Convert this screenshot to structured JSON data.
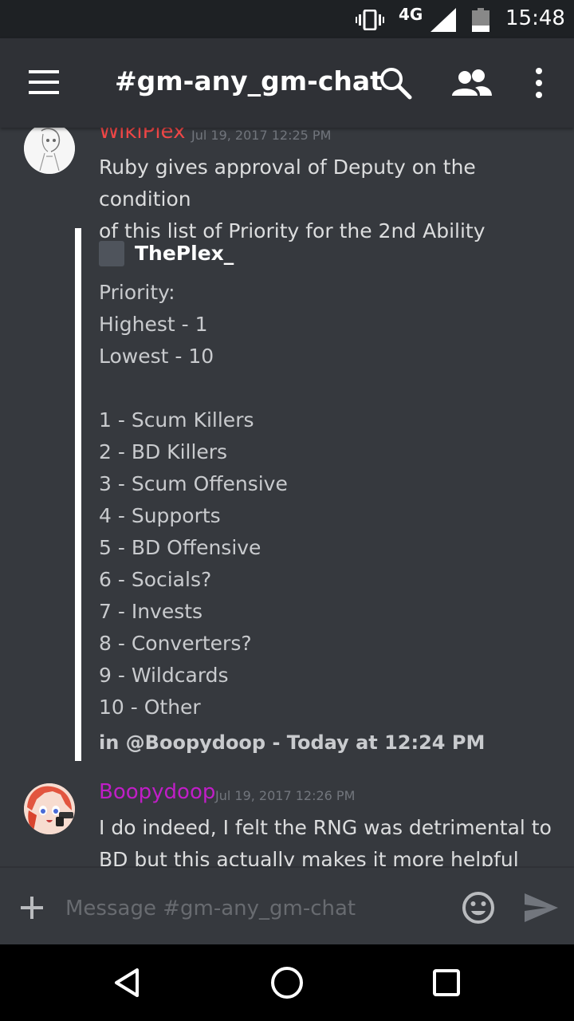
{
  "status_bar": {
    "network": "4G",
    "time": "15:48"
  },
  "header": {
    "channel_title": "#gm-any_gm-chat"
  },
  "messages": [
    {
      "author": "WikiPlex",
      "author_color": "#f04747",
      "timestamp": "Jul 19, 2017 12:25 PM",
      "lines": [
        "Ruby gives approval of Deputy on the condition",
        "of this list of Priority for the 2nd Ability"
      ],
      "embed": {
        "author": "ThePlex_",
        "body": "Priority:\nHighest - 1\nLowest - 10\n\n1 - Scum Killers\n2 - BD Killers\n3 - Scum Offensive\n4 - Supports\n5 - BD Offensive\n6 - Socials?\n7 - Invests\n8 - Converters?\n9 - Wildcards\n10 - Other",
        "footer": "in @Boopydoop - Today at 12:24 PM"
      }
    },
    {
      "author": "Boopydoop",
      "author_color": "#c01ec7",
      "timestamp": "Jul 19, 2017 12:26 PM",
      "lines": [
        "I do indeed, I felt the RNG was detrimental to",
        "BD but this actually makes it more helpful"
      ]
    }
  ],
  "input": {
    "placeholder": "Message #gm-any_gm-chat"
  }
}
